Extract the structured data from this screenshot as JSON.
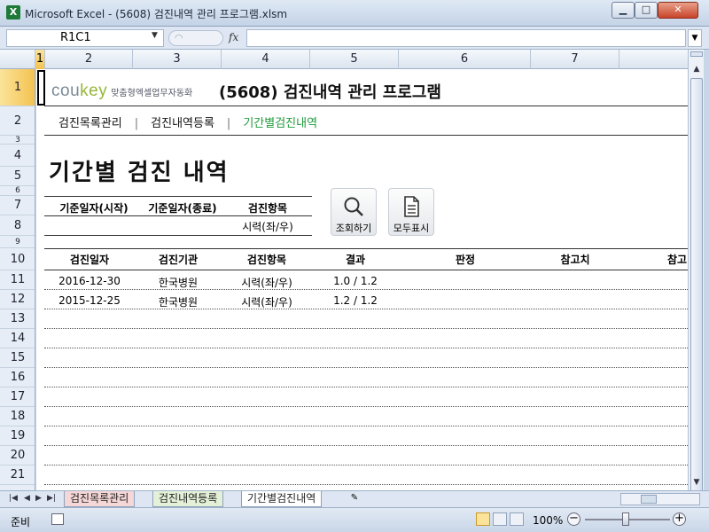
{
  "window": {
    "title": "Microsoft Excel - (5608) 검진내역 관리 프로그램.xlsm",
    "app_icon": "X",
    "minimize": "▁",
    "maximize": "□",
    "close": "✕"
  },
  "formula_bar": {
    "name_box": "R1C1",
    "fx": "fx",
    "value": ""
  },
  "columns": [
    "1",
    "2",
    "3",
    "4",
    "5",
    "6",
    "7"
  ],
  "rows": [
    "1",
    "2",
    "3",
    "4",
    "5",
    "6",
    "7",
    "8",
    "9",
    "10",
    "11",
    "12",
    "13",
    "14",
    "15",
    "16",
    "17",
    "18",
    "19",
    "20",
    "21"
  ],
  "logo": {
    "brand_a": "cou",
    "brand_b": "key",
    "tagline": "맞춤형엑셀업무자동화"
  },
  "program_title": "(5608) 검진내역 관리 프로그램",
  "nav": {
    "items": [
      "검진목록관리",
      "검진내역등록",
      "기간별검진내역"
    ],
    "separator": "|"
  },
  "page_heading": "기간별 검진 내역",
  "filter": {
    "start_label": "기준일자(시작)",
    "end_label": "기준일자(종료)",
    "item_label": "검진항목",
    "item_value": "시력(좌/우)",
    "start_value": "",
    "end_value": ""
  },
  "buttons": {
    "search": "조회하기",
    "show_all": "모두표시"
  },
  "table": {
    "headers": [
      "검진일자",
      "검진기관",
      "검진항목",
      "결과",
      "판정",
      "참고치",
      "참고"
    ],
    "rows": [
      [
        "2016-12-30",
        "한국병원",
        "시력(좌/우)",
        "1.0 / 1.2",
        "",
        ""
      ],
      [
        "2015-12-25",
        "한국병원",
        "시력(좌/우)",
        "1.2 / 1.2",
        "",
        ""
      ]
    ]
  },
  "sheet_tabs": [
    "검진목록관리",
    "검진내역등록",
    "기간별검진내역"
  ],
  "status": {
    "ready": "준비",
    "zoom": "100%"
  },
  "colors": {
    "accent_green": "#1e9a3a",
    "tab_pink": "#f6d7d7",
    "tab_green": "#e4f1d8",
    "logo_green": "#95b83a"
  }
}
